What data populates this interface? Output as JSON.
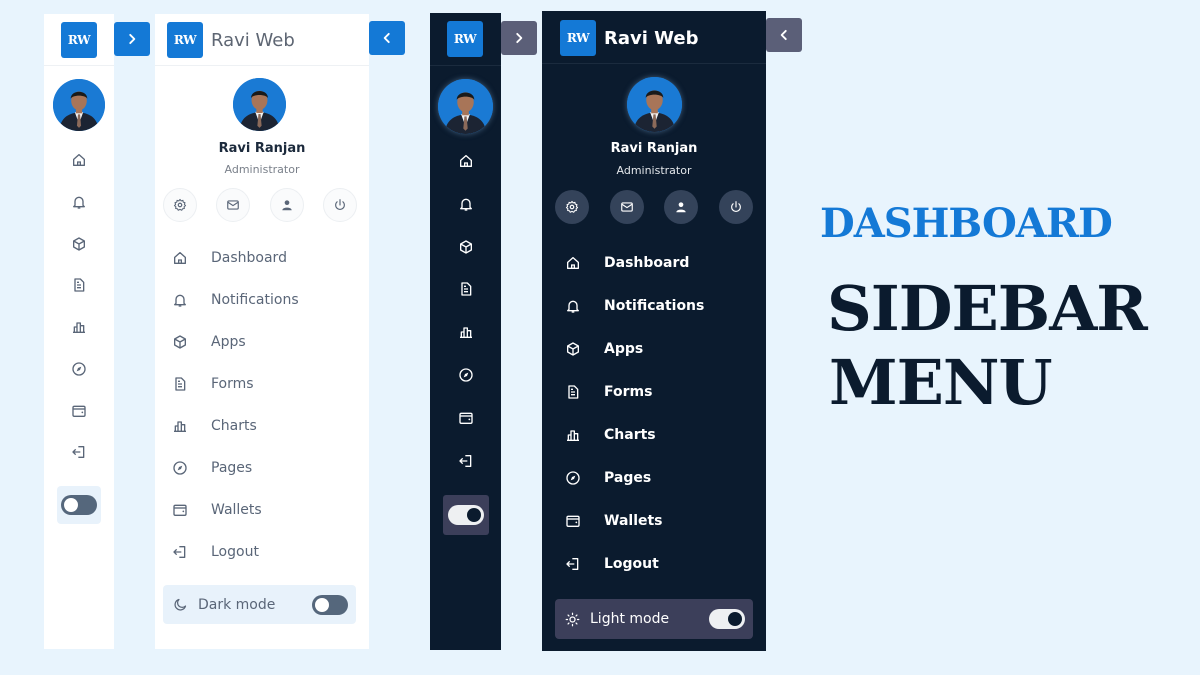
{
  "brand": {
    "logo_text": "RW",
    "name": "Ravi Web"
  },
  "profile": {
    "name": "Ravi Ranjan",
    "role": "Administrator"
  },
  "quick_actions": [
    {
      "icon": "gear-icon",
      "label": "Settings"
    },
    {
      "icon": "mail-icon",
      "label": "Messages"
    },
    {
      "icon": "user-icon",
      "label": "Profile"
    },
    {
      "icon": "power-icon",
      "label": "Power"
    }
  ],
  "menu": [
    {
      "label": "Dashboard",
      "icon": "home-icon"
    },
    {
      "label": "Notifications",
      "icon": "bell-icon"
    },
    {
      "label": "Apps",
      "icon": "cube-icon"
    },
    {
      "label": "Forms",
      "icon": "document-icon"
    },
    {
      "label": "Charts",
      "icon": "bar-chart-icon"
    },
    {
      "label": "Pages",
      "icon": "compass-icon"
    },
    {
      "label": "Wallets",
      "icon": "wallet-icon"
    },
    {
      "label": "Logout",
      "icon": "logout-icon"
    }
  ],
  "light_panel": {
    "mode_label": "Dark mode",
    "mode_icon": "moon-icon",
    "toggle_on": false,
    "collapsed_arrow": "chevron-right-icon",
    "expanded_arrow": "chevron-left-icon"
  },
  "dark_panel": {
    "mode_label": "Light mode",
    "mode_icon": "sun-icon",
    "toggle_on": true,
    "collapsed_arrow": "chevron-right-icon",
    "expanded_arrow": "chevron-left-icon"
  },
  "headline": {
    "line1": "DASHBOARD",
    "line2": "SIDEBAR",
    "line3": "MENU"
  },
  "colors": {
    "accent": "#1479d6",
    "dark_bg": "#0b1b2e",
    "page_bg": "#e8f4fd",
    "headline_dark": "#0b1b2e"
  }
}
